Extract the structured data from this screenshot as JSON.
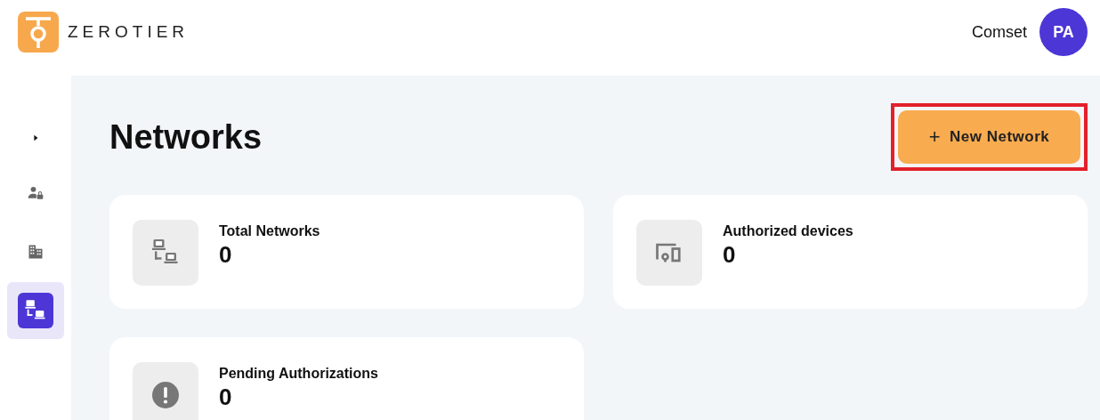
{
  "header": {
    "logo_text": "ZEROTIER",
    "account": "Comset",
    "avatar": "PA"
  },
  "sidebar": {
    "items": [
      {
        "kind": "expand",
        "selected": false
      },
      {
        "kind": "users",
        "selected": false
      },
      {
        "kind": "organization",
        "selected": false
      },
      {
        "kind": "networks",
        "selected": true
      }
    ]
  },
  "page": {
    "title": "Networks",
    "new_button": {
      "label": "New Network",
      "icon": "+",
      "highlighted": true
    }
  },
  "stats": [
    {
      "kind": "networks",
      "label": "Total Networks",
      "value": "0"
    },
    {
      "kind": "devices",
      "label": "Authorized devices",
      "value": "0"
    },
    {
      "kind": "pending",
      "label": "Pending Authorizations",
      "value": "0"
    }
  ]
}
